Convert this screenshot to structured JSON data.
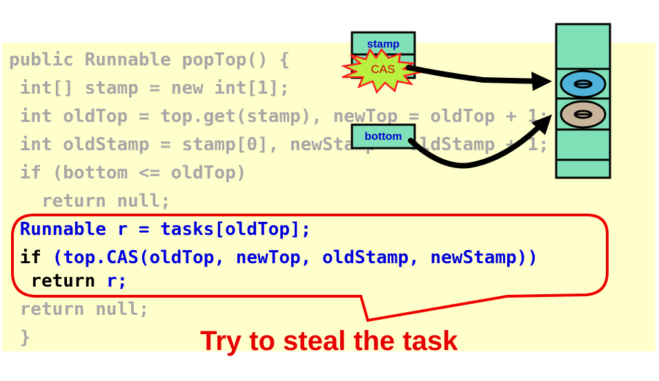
{
  "code": {
    "line1": "public Runnable popTop() {",
    "line2": " int[] stamp = new int[1];",
    "line3": " int oldTop = top.get(stamp), newTop = oldTop + 1;",
    "line4": " int oldStamp = stamp[0], newStamp = oldStamp + 1;",
    "line5": " if (bottom <= oldTop)",
    "line6": "   return null;",
    "line7": " Runnable r = tasks[oldTop];",
    "line8_kw": " if",
    "line8_rest": " (top.CAS(oldTop, newTop, oldStamp, newStamp))",
    "line9_kw": "  return",
    "line9_rest": " r;",
    "line10": " return null;",
    "line11": " }"
  },
  "diagram": {
    "stamp_label": "stamp",
    "cas_label": "CAS",
    "bottom_label": "bottom"
  },
  "caption": "Try to steal the task",
  "colors": {
    "code_background": "#ffffcc",
    "highlight_border": "#ee0000",
    "active_code": "#0000dd",
    "dim_code": "#a6a6a6",
    "queue_fill": "#80e0b8",
    "task_blue": "#4fb3d9",
    "task_tan": "#c8b49a",
    "caption": "#e60000"
  }
}
